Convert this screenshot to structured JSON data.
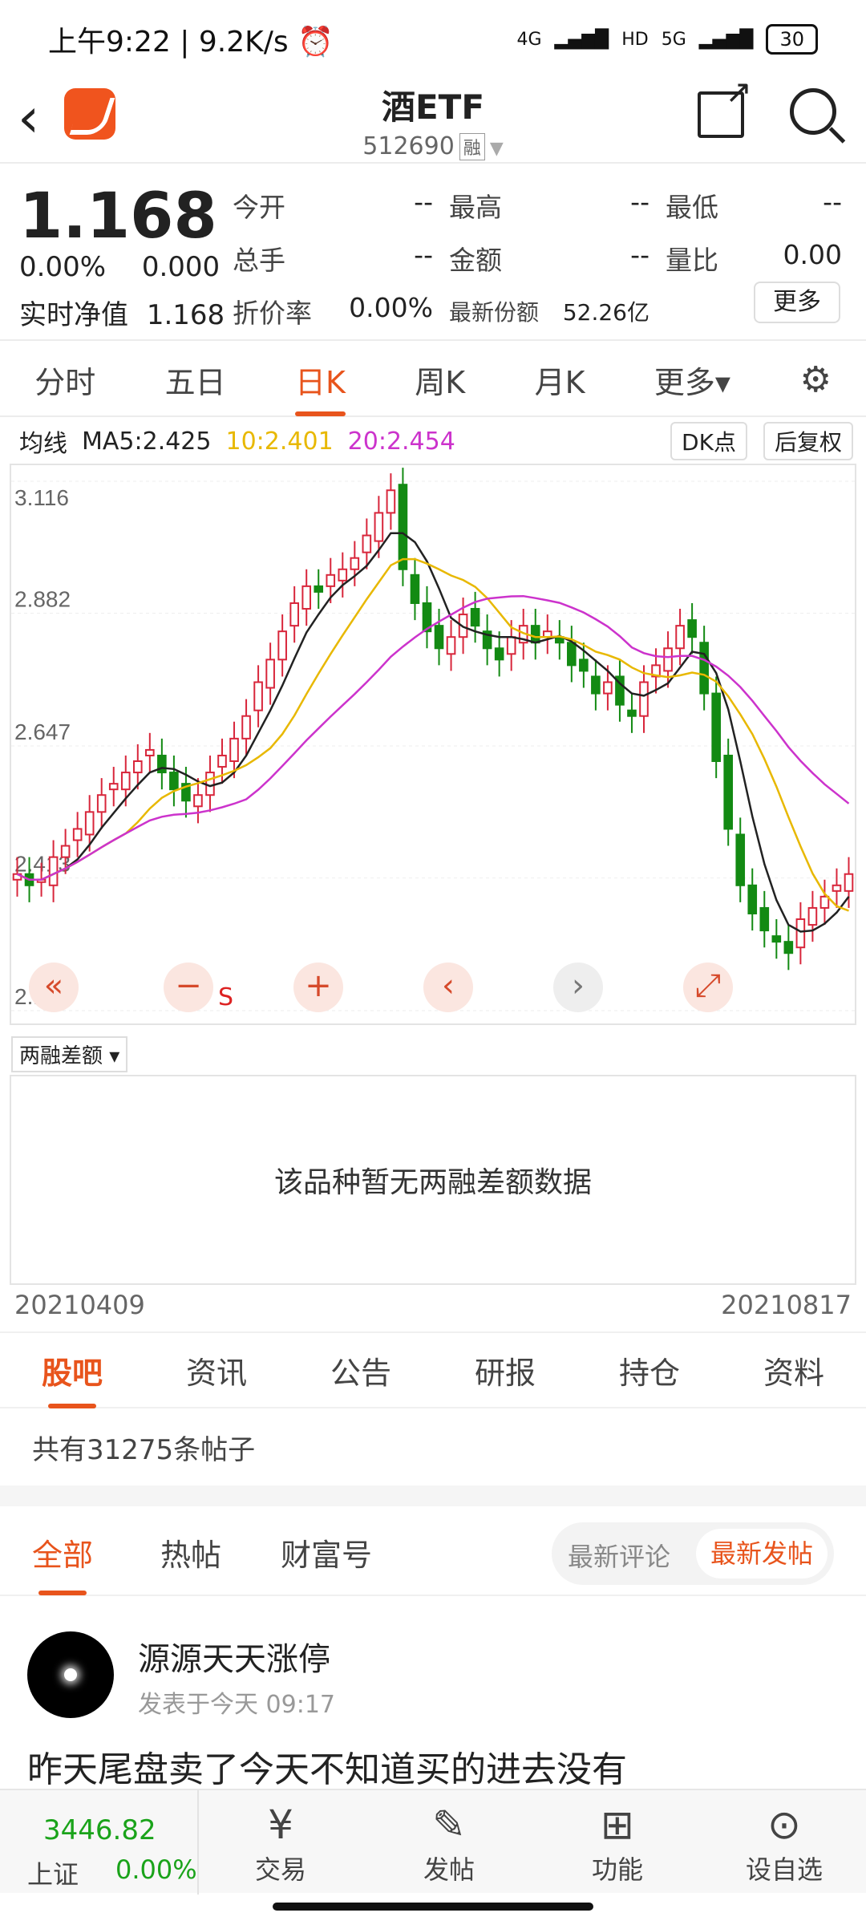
{
  "status": {
    "time": "上午9:22",
    "speed": "9.2K/s",
    "net1": "4G",
    "hd": "HD",
    "net2": "5G",
    "battery": "30"
  },
  "header": {
    "title": "酒ETF",
    "code": "512690",
    "badge": "融"
  },
  "quote": {
    "price": "1.168",
    "change_pct": "0.00%",
    "change_abs": "0.000",
    "nav_label": "实时净值",
    "nav_value": "1.168",
    "premium_label": "折价率",
    "premium_value": "0.00%",
    "share_label": "最新份额",
    "share_value": "52.26亿",
    "open_label": "今开",
    "open_value": "--",
    "high_label": "最高",
    "high_value": "--",
    "low_label": "最低",
    "low_value": "--",
    "volume_label": "总手",
    "volume_value": "--",
    "amount_label": "金额",
    "amount_value": "--",
    "ratio_label": "量比",
    "ratio_value": "0.00",
    "more": "更多"
  },
  "tabs": [
    "分时",
    "五日",
    "日K",
    "周K",
    "月K",
    "更多▾"
  ],
  "ma": {
    "label": "均线",
    "ma5": "MA5:2.425",
    "ma10": "10:2.401",
    "ma20": "20:2.454",
    "dk": "DK点",
    "adjust": "后复权",
    "ma10_color": "#e8b800",
    "ma20_color": "#cc33cc"
  },
  "chart_data": {
    "type": "candlestick",
    "ylabels": [
      "3.116",
      "2.882",
      "2.647",
      "2.413",
      "2.178"
    ],
    "ylim": [
      2.178,
      3.116
    ],
    "x_start": "20210409",
    "x_end": "20210817",
    "closes": [
      2.42,
      2.4,
      2.41,
      2.45,
      2.47,
      2.5,
      2.53,
      2.56,
      2.58,
      2.6,
      2.62,
      2.64,
      2.6,
      2.57,
      2.55,
      2.56,
      2.6,
      2.63,
      2.66,
      2.7,
      2.76,
      2.8,
      2.85,
      2.9,
      2.93,
      2.92,
      2.95,
      2.96,
      2.98,
      3.02,
      3.06,
      3.1,
      2.96,
      2.9,
      2.85,
      2.82,
      2.84,
      2.88,
      2.86,
      2.82,
      2.8,
      2.84,
      2.86,
      2.83,
      2.85,
      2.83,
      2.79,
      2.78,
      2.74,
      2.76,
      2.72,
      2.7,
      2.76,
      2.79,
      2.82,
      2.86,
      2.84,
      2.74,
      2.62,
      2.5,
      2.4,
      2.35,
      2.32,
      2.3,
      2.28,
      2.34,
      2.36,
      2.38,
      2.4,
      2.42
    ]
  },
  "chart_ctrls": {
    "far_back": "«",
    "zoom_out": "−",
    "zoom_in": "+",
    "prev": "‹",
    "next": "›",
    "expand": "⤢",
    "s_mark": "S"
  },
  "margin": {
    "selector": "两融差额 ▾",
    "empty": "该品种暂无两融差额数据"
  },
  "subtabs": [
    "股吧",
    "资讯",
    "公告",
    "研报",
    "持仓",
    "资料"
  ],
  "forum": {
    "count": "共有31275条帖子",
    "filters": [
      "全部",
      "热帖",
      "财富号"
    ],
    "sort_a": "最新评论",
    "sort_b": "最新发帖",
    "post": {
      "author": "源源天天涨停",
      "time": "发表于今天 09:17",
      "text": "昨天尾盘卖了今天不知道买的进去没有"
    }
  },
  "bottom": {
    "index_value": "3446.82",
    "index_name": "上证",
    "index_change": "0.00%",
    "items": [
      "交易",
      "发帖",
      "功能",
      "设自选"
    ]
  }
}
